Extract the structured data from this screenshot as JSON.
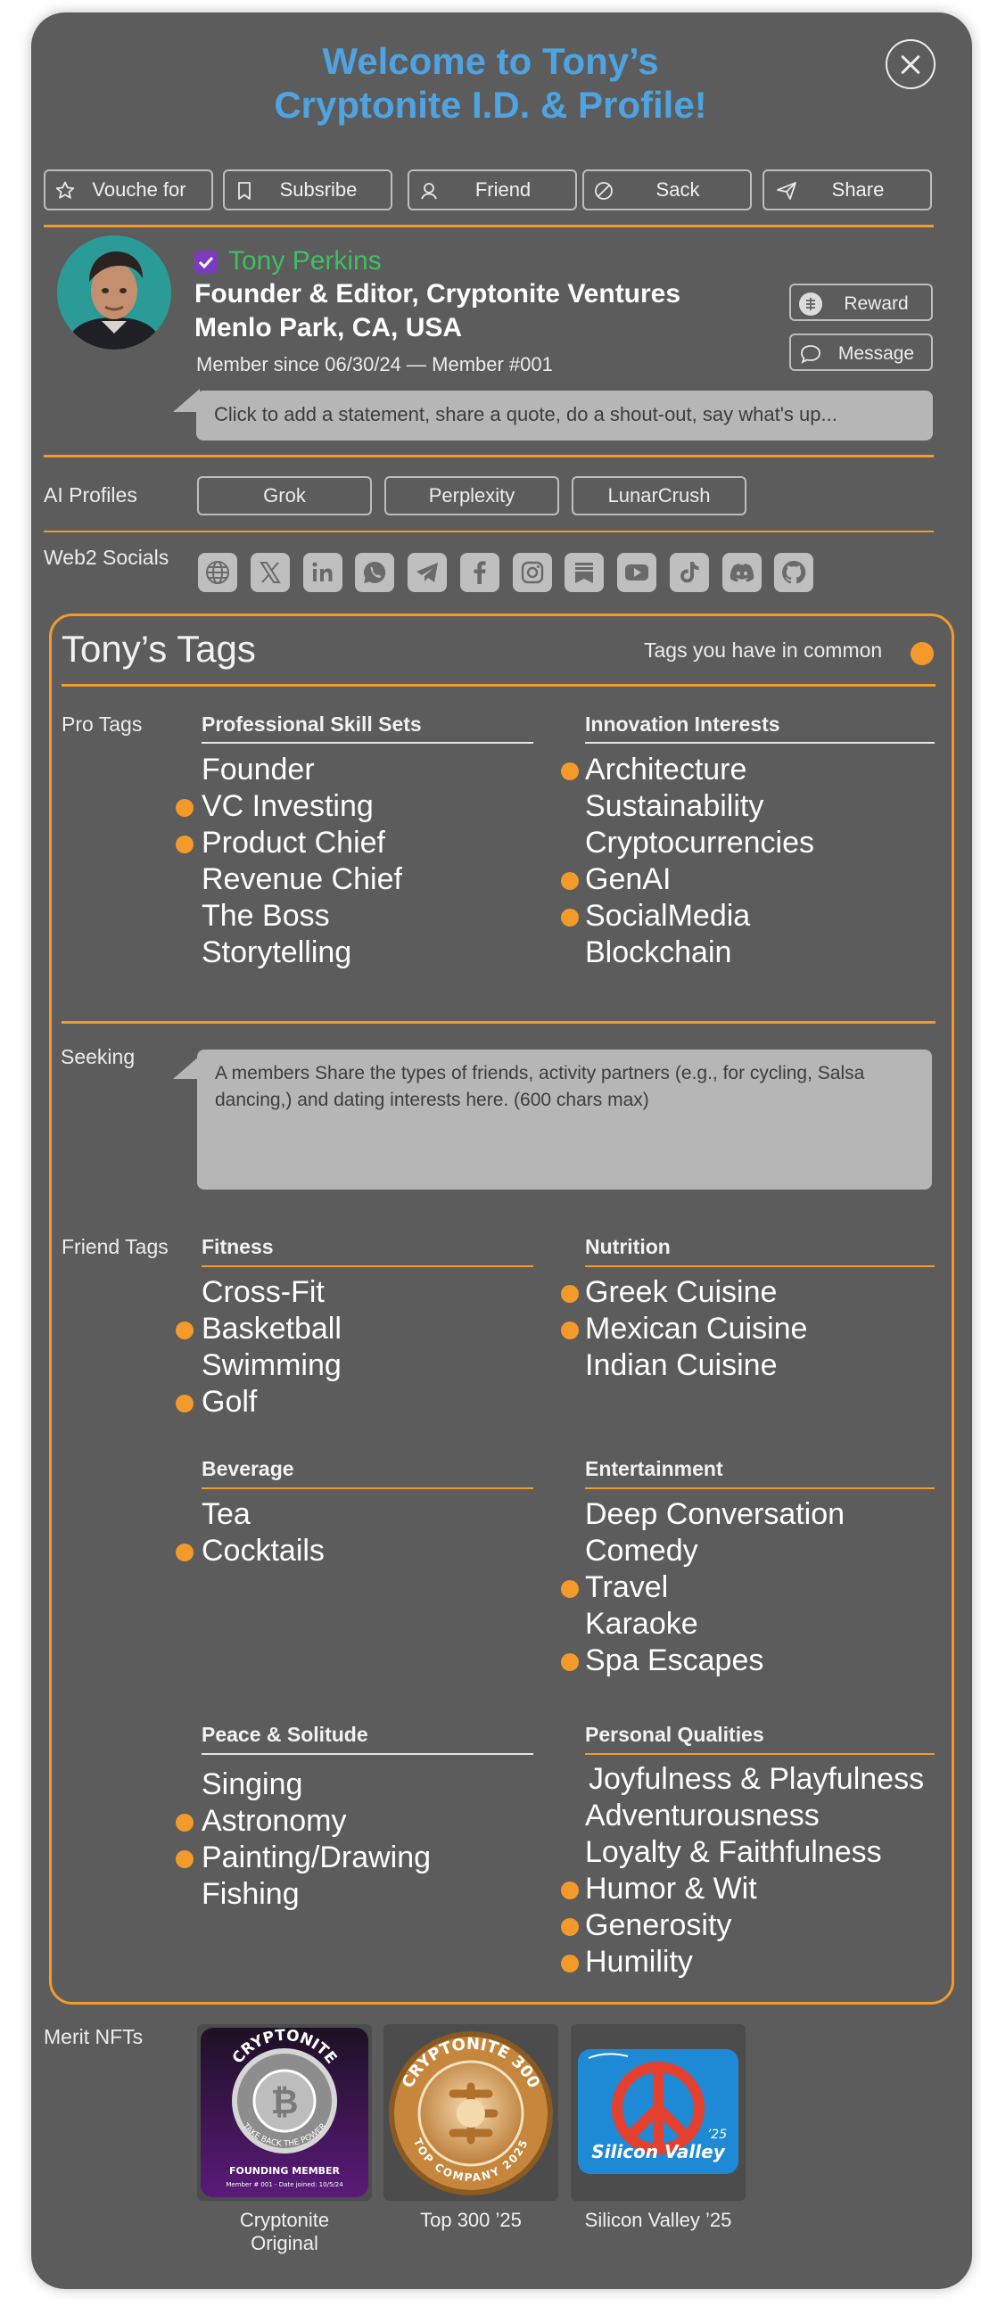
{
  "header": {
    "title_line1": "Welcome to Tony’s",
    "title_line2": "Cryptonite I.D. & Profile!"
  },
  "actions": [
    {
      "label": "Vouche for",
      "icon": "star-icon"
    },
    {
      "label": "Subsribe",
      "icon": "bookmark-icon"
    },
    {
      "label": "Friend",
      "icon": "friend-icon"
    },
    {
      "label": "Sack",
      "icon": "block-icon"
    },
    {
      "label": "Share",
      "icon": "send-icon"
    }
  ],
  "profile": {
    "name": "Tony Perkins",
    "title": "Founder & Editor, Cryptonite Ventures",
    "location": "Menlo Park, CA, USA",
    "member_since": "Member since 06/30/24 — Member #001",
    "statement_placeholder": "Click to add a statement, share a quote, do a shout-out, say what's up...",
    "reward_label": "Reward",
    "message_label": "Message"
  },
  "ai_profiles": {
    "label": "AI Profiles",
    "items": [
      "Grok",
      "Perplexity",
      "LunarCrush"
    ]
  },
  "socials": {
    "label": "Web2 Socials",
    "icons": [
      "globe-icon",
      "x-icon",
      "linkedin-icon",
      "whatsapp-icon",
      "telegram-icon",
      "facebook-icon",
      "instagram-icon",
      "substack-icon",
      "youtube-icon",
      "tiktok-icon",
      "discord-icon",
      "github-icon"
    ]
  },
  "tags": {
    "title": "Tony’s Tags",
    "common_legend": "Tags you have in common",
    "pro_label": "Pro Tags",
    "skills": {
      "title": "Professional Skill Sets",
      "items": [
        {
          "label": "Founder",
          "common": false
        },
        {
          "label": "VC Investing",
          "common": true
        },
        {
          "label": "Product Chief",
          "common": true
        },
        {
          "label": "Revenue Chief",
          "common": false
        },
        {
          "label": "The Boss",
          "common": false
        },
        {
          "label": "Storytelling",
          "common": false
        }
      ]
    },
    "innovation": {
      "title": "Innovation Interests",
      "items": [
        {
          "label": "Architecture",
          "common": true
        },
        {
          "label": "Sustainability",
          "common": false
        },
        {
          "label": "Cryptocurrencies",
          "common": false
        },
        {
          "label": "GenAI",
          "common": true
        },
        {
          "label": "SocialMedia",
          "common": true
        },
        {
          "label": "Blockchain",
          "common": false
        }
      ]
    },
    "seeking_label": "Seeking",
    "seeking_text": "A members Share the types of friends, activity partners (e.g., for cycling, Salsa dancing,) and dating interests here. (600  chars max)",
    "friend_label": "Friend Tags",
    "fitness": {
      "title": "Fitness",
      "items": [
        {
          "label": "Cross-Fit",
          "common": false
        },
        {
          "label": "Basketball",
          "common": true
        },
        {
          "label": "Swimming",
          "common": false
        },
        {
          "label": "Golf",
          "common": true
        }
      ]
    },
    "nutrition": {
      "title": "Nutrition",
      "items": [
        {
          "label": "Greek Cuisine",
          "common": true
        },
        {
          "label": "Mexican Cuisine",
          "common": true
        },
        {
          "label": "Indian Cuisine",
          "common": false
        }
      ]
    },
    "beverage": {
      "title": "Beverage",
      "items": [
        {
          "label": "Tea",
          "common": false
        },
        {
          "label": "Cocktails",
          "common": true
        }
      ]
    },
    "entertainment": {
      "title": "Entertainment",
      "items": [
        {
          "label": "Deep Conversation",
          "common": false
        },
        {
          "label": "Comedy",
          "common": false
        },
        {
          "label": "Travel",
          "common": true
        },
        {
          "label": "Karaoke",
          "common": false
        },
        {
          "label": "Spa Escapes",
          "common": true
        }
      ]
    },
    "peace": {
      "title": "Peace & Solitude",
      "items": [
        {
          "label": "Singing",
          "common": false
        },
        {
          "label": "Astronomy",
          "common": true
        },
        {
          "label": "Painting/Drawing",
          "common": true
        },
        {
          "label": "Fishing",
          "common": false
        }
      ]
    },
    "qualities": {
      "title": "Personal Qualities",
      "items": [
        {
          "label": "Joyfulness & Playfulness",
          "common": false
        },
        {
          "label": "Adventurousness",
          "common": false
        },
        {
          "label": "Loyalty & Faithfulness",
          "common": false
        },
        {
          "label": "Humor & Wit",
          "common": true
        },
        {
          "label": "Generosity",
          "common": true
        },
        {
          "label": "Humility",
          "common": true
        }
      ]
    }
  },
  "nfts": {
    "label": "Merit NFTs",
    "items": [
      {
        "caption_line1": "Cryptonite",
        "caption_line2": "Original",
        "badge_top": "CRYPTONITE",
        "badge_ring": "TAKE BACK THE POWER",
        "badge_sub": "FOUNDING MEMBER",
        "badge_fine": "Member # 001 - Date joined: 10/5/24"
      },
      {
        "caption_line1": "Top 300 ’25",
        "caption_line2": "",
        "badge_top": "CRYPTONITE 300",
        "badge_ring": "TOP COMPANY 2025"
      },
      {
        "caption_line1": "Silicon Valley ’25",
        "caption_line2": "",
        "badge_top": "Silicon Valley",
        "badge_year": "’25"
      }
    ]
  },
  "colors": {
    "accent": "#f39a2a",
    "title_blue": "#4ea3e0",
    "name_green": "#3fbf62",
    "card_bg": "#5c5c5c"
  }
}
